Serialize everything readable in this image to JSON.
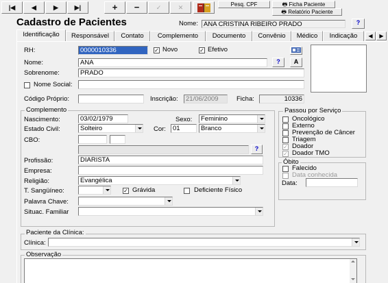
{
  "toolbar": {
    "first": "|◀",
    "prev": "◀",
    "next": "▶",
    "last": "▶|",
    "add": "+",
    "remove": "−",
    "confirm": "✓",
    "cancel": "✕",
    "pesq_cpf": "Pesq. CPF",
    "ficha_paciente": "Ficha Paciente",
    "relatorio_paciente": "Relatório Paciente"
  },
  "header": {
    "title": "Cadastro de Pacientes",
    "nome_label": "Nome:",
    "nome_value": "ANA CRISTINA RIBEIRO PRADO",
    "help": "?"
  },
  "tabs": [
    "Identificação",
    "Responsável",
    "Contato",
    "Complemento",
    "Documento",
    "Convênio",
    "Médico",
    "Indicação"
  ],
  "ident": {
    "rh_label": "RH:",
    "rh_value": "0000010336",
    "novo_label": "Novo",
    "novo_checked": "✓",
    "efetivo_label": "Efetivo",
    "efetivo_checked": "✓",
    "nome_label": "Nome:",
    "nome_value": "ANA",
    "sobrenome_label": "Sobrenome:",
    "sobrenome_value": "PRADO",
    "nome_social_label": "Nome Social:",
    "nome_social_value": "",
    "codigo_label": "Código Próprio:",
    "codigo_value": "",
    "inscricao_label": "Inscrição:",
    "inscricao_value": "21/06/2009",
    "ficha_label": "Ficha:",
    "ficha_value": "10336",
    "help": "?",
    "font_btn": "A"
  },
  "complemento": {
    "title": "Complemento",
    "nascimento_label": "Nascimento:",
    "nascimento_value": "03/02/1979",
    "sexo_label": "Sexo:",
    "sexo_value": "Feminino",
    "estado_civil_label": "Estado Civil:",
    "estado_civil_value": "Solteiro",
    "cor_label": "Cor:",
    "cor_code": "01",
    "cor_value": "Branco",
    "cbo_label": "CBO:",
    "cbo_help": "?",
    "profissao_label": "Profissão:",
    "profissao_value": "DIARISTA",
    "empresa_label": "Empresa:",
    "empresa_value": "",
    "religiao_label": "Religião:",
    "religiao_value": "Evangélica",
    "sangue_label": "T. Sangüíneo:",
    "sangue_value": "",
    "gravida_label": "Grávida",
    "gravida_checked": "✓",
    "deficiente_label": "Deficiente Físico",
    "palavra_label": "Palavra Chave:",
    "palavra_value": "",
    "situac_label": "Situac. Familiar",
    "situac_value": ""
  },
  "passou": {
    "title": "Passou por Serviço",
    "items": [
      {
        "label": "Oncológico",
        "mark": ""
      },
      {
        "label": "Externo",
        "mark": ""
      },
      {
        "label": "Prevenção de Câncer",
        "mark": ""
      },
      {
        "label": "Triagem",
        "mark": ""
      },
      {
        "label": "Doador",
        "mark": "✓"
      },
      {
        "label": "Doador TMO",
        "mark": "✓"
      }
    ]
  },
  "obito": {
    "title": "Óbito",
    "falecido_label": "Falecido",
    "data_conhecida_label": "Data conhecida",
    "data_label": "Data:",
    "data_value": ""
  },
  "clinica": {
    "title": "Paciente da Clínica:",
    "label": "Clínica:",
    "value": ""
  },
  "observacao": {
    "title": "Observação",
    "value": ""
  }
}
